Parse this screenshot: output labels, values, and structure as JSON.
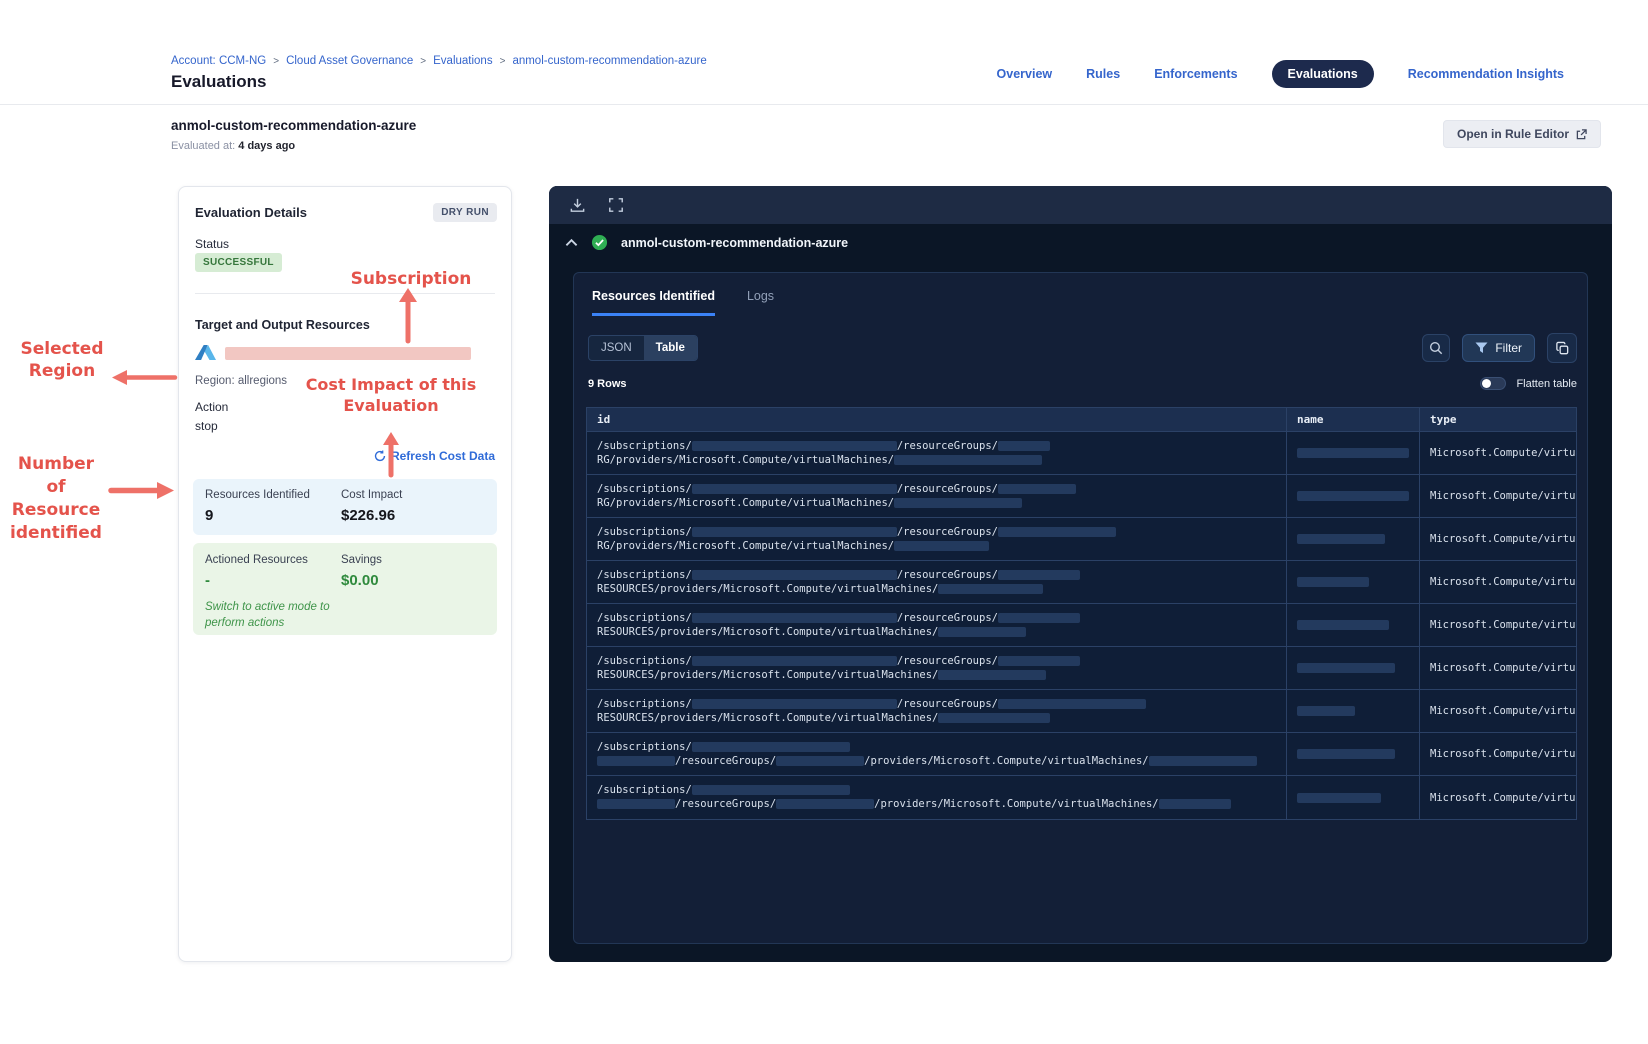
{
  "header": {
    "breadcrumb": [
      "Account: CCM-NG",
      "Cloud Asset Governance",
      "Evaluations",
      "anmol-custom-recommendation-azure"
    ],
    "separator": ">",
    "page_title": "Evaluations",
    "tabs": [
      {
        "label": "Overview",
        "active": false
      },
      {
        "label": "Rules",
        "active": false
      },
      {
        "label": "Enforcements",
        "active": false
      },
      {
        "label": "Evaluations",
        "active": true
      },
      {
        "label": "Recommendation Insights",
        "active": false
      }
    ]
  },
  "subheader": {
    "title": "anmol-custom-recommendation-azure",
    "evaluated_at_label": "Evaluated at:",
    "evaluated_at_value": "4 days ago",
    "rule_editor_button": "Open in Rule Editor"
  },
  "annotations": {
    "color": "#e4534b",
    "subscription": "Subscription",
    "selected_region_line1": "Selected",
    "selected_region_line2": "Region",
    "cost_impact_line1": "Cost Impact of this",
    "cost_impact_line2": "Evaluation",
    "count_line1": "Number of",
    "count_line2": "Resource",
    "count_line3": "identified"
  },
  "details": {
    "title": "Evaluation Details",
    "mode_badge": "DRY RUN",
    "status_label": "Status",
    "status_value": "SUCCESSFUL",
    "target_label": "Target and Output Resources",
    "cloud_icon": "azure-icon",
    "region": "Region: allregions",
    "action_label": "Action",
    "action_value": "stop",
    "refresh_link": "Refresh Cost Data",
    "stats": {
      "resources_label": "Resources Identified",
      "resources_value": "9",
      "cost_label": "Cost Impact",
      "cost_value": "$226.96"
    },
    "actioned": {
      "actioned_label": "Actioned Resources",
      "actioned_value": "-",
      "savings_label": "Savings",
      "savings_value": "$0.00",
      "note_line1": "Switch to active mode to",
      "note_line2": "perform actions"
    }
  },
  "results": {
    "title": "anmol-custom-recommendation-azure",
    "status_icon": "success-check-icon",
    "tabs": [
      {
        "label": "Resources Identified",
        "active": true
      },
      {
        "label": "Logs",
        "active": false
      }
    ],
    "view_toggle": [
      {
        "label": "JSON",
        "active": false
      },
      {
        "label": "Table",
        "active": true
      }
    ],
    "filter_button": "Filter",
    "rows_count": "9 Rows",
    "flatten_label": "Flatten table",
    "flatten_enabled": false,
    "table": {
      "columns": [
        "id",
        "name",
        "type"
      ],
      "rows": [
        {
          "id1": [
            [
              "t",
              "/subscriptions/"
            ],
            [
              "b",
              205
            ],
            [
              "t",
              "/resourceGroups/"
            ],
            [
              "b",
              52
            ]
          ],
          "id2": [
            [
              "t",
              "RG/providers/Microsoft.Compute/virtualMachines/"
            ],
            [
              "b",
              148
            ]
          ],
          "name_bar": 118,
          "type": "Microsoft.Compute/virtu"
        },
        {
          "id1": [
            [
              "t",
              "/subscriptions/"
            ],
            [
              "b",
              205
            ],
            [
              "t",
              "/resourceGroups/"
            ],
            [
              "b",
              78
            ]
          ],
          "id2": [
            [
              "t",
              "RG/providers/Microsoft.Compute/virtualMachines/"
            ],
            [
              "b",
              128
            ]
          ],
          "name_bar": 118,
          "type": "Microsoft.Compute/virtu"
        },
        {
          "id1": [
            [
              "t",
              "/subscriptions/"
            ],
            [
              "b",
              205
            ],
            [
              "t",
              "/resourceGroups/"
            ],
            [
              "b",
              118
            ]
          ],
          "id2": [
            [
              "t",
              "RG/providers/Microsoft.Compute/virtualMachines/"
            ],
            [
              "b",
              95
            ]
          ],
          "name_bar": 88,
          "type": "Microsoft.Compute/virtu"
        },
        {
          "id1": [
            [
              "t",
              "/subscriptions/"
            ],
            [
              "b",
              205
            ],
            [
              "t",
              "/resourceGroups/"
            ],
            [
              "b",
              82
            ]
          ],
          "id2": [
            [
              "t",
              "RESOURCES/providers/Microsoft.Compute/virtualMachines/"
            ],
            [
              "b",
              105
            ]
          ],
          "name_bar": 72,
          "type": "Microsoft.Compute/virtu"
        },
        {
          "id1": [
            [
              "t",
              "/subscriptions/"
            ],
            [
              "b",
              205
            ],
            [
              "t",
              "/resourceGroups/"
            ],
            [
              "b",
              82
            ]
          ],
          "id2": [
            [
              "t",
              "RESOURCES/providers/Microsoft.Compute/virtualMachines/"
            ],
            [
              "b",
              88
            ]
          ],
          "name_bar": 92,
          "type": "Microsoft.Compute/virtu"
        },
        {
          "id1": [
            [
              "t",
              "/subscriptions/"
            ],
            [
              "b",
              205
            ],
            [
              "t",
              "/resourceGroups/"
            ],
            [
              "b",
              82
            ]
          ],
          "id2": [
            [
              "t",
              "RESOURCES/providers/Microsoft.Compute/virtualMachines/"
            ],
            [
              "b",
              108
            ]
          ],
          "name_bar": 98,
          "type": "Microsoft.Compute/virtu"
        },
        {
          "id1": [
            [
              "t",
              "/subscriptions/"
            ],
            [
              "b",
              205
            ],
            [
              "t",
              "/resourceGroups/"
            ],
            [
              "b",
              148
            ]
          ],
          "id2": [
            [
              "t",
              "RESOURCES/providers/Microsoft.Compute/virtualMachines/"
            ],
            [
              "b",
              112
            ]
          ],
          "name_bar": 58,
          "type": "Microsoft.Compute/virtu"
        },
        {
          "id1": [
            [
              "t",
              "/subscriptions/"
            ],
            [
              "b",
              158
            ]
          ],
          "id2": [
            [
              "b",
              78
            ],
            [
              "t",
              "/resourceGroups/"
            ],
            [
              "b",
              88
            ],
            [
              "t",
              "/providers/Microsoft.Compute/virtualMachines/"
            ],
            [
              "b",
              108
            ]
          ],
          "name_bar": 98,
          "type": "Microsoft.Compute/virtu"
        },
        {
          "id1": [
            [
              "t",
              "/subscriptions/"
            ],
            [
              "b",
              158
            ]
          ],
          "id2": [
            [
              "b",
              78
            ],
            [
              "t",
              "/resourceGroups/"
            ],
            [
              "b",
              98
            ],
            [
              "t",
              "/providers/Microsoft.Compute/virtualMachines/"
            ],
            [
              "b",
              72
            ]
          ],
          "name_bar": 84,
          "type": "Microsoft.Compute/virtu"
        }
      ]
    }
  }
}
